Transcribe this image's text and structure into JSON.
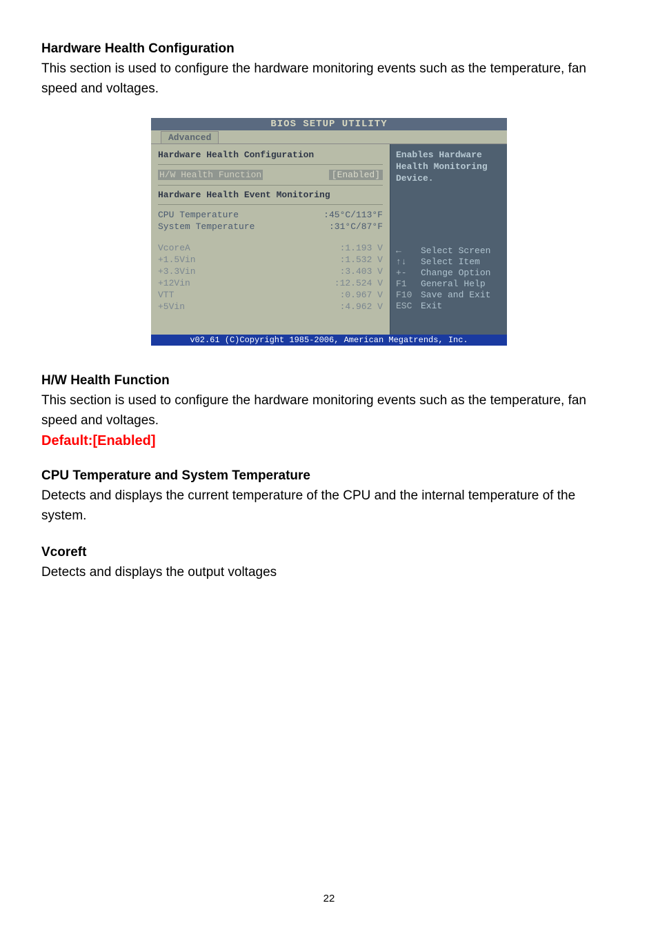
{
  "sections": {
    "hhc": {
      "heading": "Hardware Health Configuration",
      "body": "This section is used to configure the hardware monitoring events such as the temperature, fan speed and voltages."
    },
    "hwhf": {
      "heading": "H/W Health Function",
      "body": "This section is used to configure the hardware monitoring events such as the temperature, fan speed and voltages.",
      "default": "Default:[Enabled]"
    },
    "cputemp": {
      "heading": "CPU Temperature and System Temperature",
      "body": "Detects and displays the current temperature of the CPU and the internal temperature of the system."
    },
    "vcoreft": {
      "heading": "Vcoreft",
      "body": "Detects and displays the output voltages"
    }
  },
  "bios": {
    "title": "BIOS SETUP UTILITY",
    "tab": "Advanced",
    "left_title": "Hardware Health Configuration",
    "hw_health_label": "H/W Health Function",
    "hw_health_value": "[Enabled]",
    "monitoring_title": "Hardware Health Event Monitoring",
    "cpu_temp_label": "CPU Temperature",
    "cpu_temp_value": ":45°C/113°F",
    "sys_temp_label": "System Temperature",
    "sys_temp_value": ":31°C/87°F",
    "voltages": [
      {
        "label": "VcoreA",
        "value": ":1.193 V"
      },
      {
        "label": "+1.5Vin",
        "value": ":1.532 V"
      },
      {
        "label": "+3.3Vin",
        "value": ":3.403 V"
      },
      {
        "label": "+12Vin",
        "value": ":12.524 V"
      },
      {
        "label": "VTT",
        "value": ":0.967 V"
      },
      {
        "label": "+5Vin",
        "value": ":4.962 V"
      }
    ],
    "right_title1": "Enables Hardware",
    "right_title2": "Health Monitoring",
    "right_title3": "Device.",
    "nav": [
      {
        "key": "←",
        "txt": "Select Screen"
      },
      {
        "key": "↑↓",
        "txt": "Select Item"
      },
      {
        "key": "+-",
        "txt": "Change Option"
      },
      {
        "key": "F1",
        "txt": "General Help"
      },
      {
        "key": "F10",
        "txt": "Save and Exit"
      },
      {
        "key": "ESC",
        "txt": "Exit"
      }
    ],
    "footer": "v02.61 (C)Copyright 1985-2006, American Megatrends, Inc."
  },
  "page_number": "22",
  "chart_data": {
    "type": "table",
    "title": "BIOS Hardware Health Readings",
    "rows": [
      {
        "label": "H/W Health Function",
        "value": "[Enabled]"
      },
      {
        "label": "CPU Temperature",
        "value": "45°C/113°F"
      },
      {
        "label": "System Temperature",
        "value": "31°C/87°F"
      },
      {
        "label": "VcoreA",
        "value": "1.193 V"
      },
      {
        "label": "+1.5Vin",
        "value": "1.532 V"
      },
      {
        "label": "+3.3Vin",
        "value": "3.403 V"
      },
      {
        "label": "+12Vin",
        "value": "12.524 V"
      },
      {
        "label": "VTT",
        "value": "0.967 V"
      },
      {
        "label": "+5Vin",
        "value": "4.962 V"
      }
    ]
  }
}
